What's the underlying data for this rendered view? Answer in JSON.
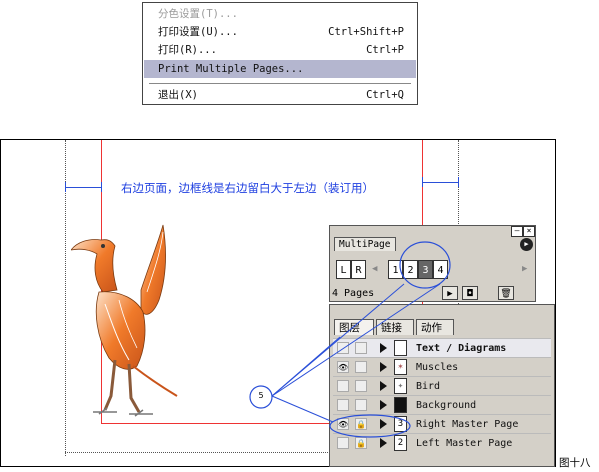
{
  "menu": {
    "items": [
      {
        "label": "分色设置(T)...",
        "shortcut": "",
        "disabled": true
      },
      {
        "label": "打印设置(U)...",
        "shortcut": "Ctrl+Shift+P"
      },
      {
        "label": "打印(R)...",
        "shortcut": "Ctrl+P"
      },
      {
        "label": "Print Multiple Pages...",
        "shortcut": "",
        "selected": true
      },
      {
        "label": "退出(X)",
        "shortcut": "Ctrl+Q"
      }
    ]
  },
  "document": {
    "annotation": "右边页面，边框线是右边留白大于左边（装订用）"
  },
  "multipage": {
    "tab": "MultiPage",
    "master_left": "L",
    "master_right": "R",
    "pages": [
      "1",
      "2",
      "3",
      "4"
    ],
    "selected_pages": [
      "3"
    ],
    "page_count": "4 Pages",
    "icons": {
      "minimize": "minimize-icon",
      "close": "close-icon",
      "menu": "palette-menu-icon",
      "play": "play-icon",
      "new_page": "new-page-icon",
      "trash": "trash-icon"
    }
  },
  "layers_panel": {
    "tabs": [
      "图层",
      "链接",
      "动作"
    ],
    "layers": [
      {
        "name": "Text / Diagrams",
        "eye": false,
        "lock": false,
        "thumb": "",
        "bold": true,
        "highlighted": true
      },
      {
        "name": "Muscles",
        "eye": true,
        "lock": false,
        "thumb": "muscles"
      },
      {
        "name": "Bird",
        "eye": false,
        "lock": false,
        "thumb": "bird"
      },
      {
        "name": "Background",
        "eye": false,
        "lock": false,
        "thumb": "background"
      },
      {
        "name": "Right Master Page",
        "eye": true,
        "lock": true,
        "thumb": "3"
      },
      {
        "name": "Left Master Page",
        "eye": false,
        "lock": true,
        "thumb": "2"
      }
    ]
  },
  "callout": {
    "label": "5"
  },
  "caption": "图十八",
  "colors": {
    "accent_blue": "#2a4fd8",
    "margin_red": "#e33333",
    "highlight": "#b4b6cf",
    "bird_orange": "#f07a2a"
  }
}
